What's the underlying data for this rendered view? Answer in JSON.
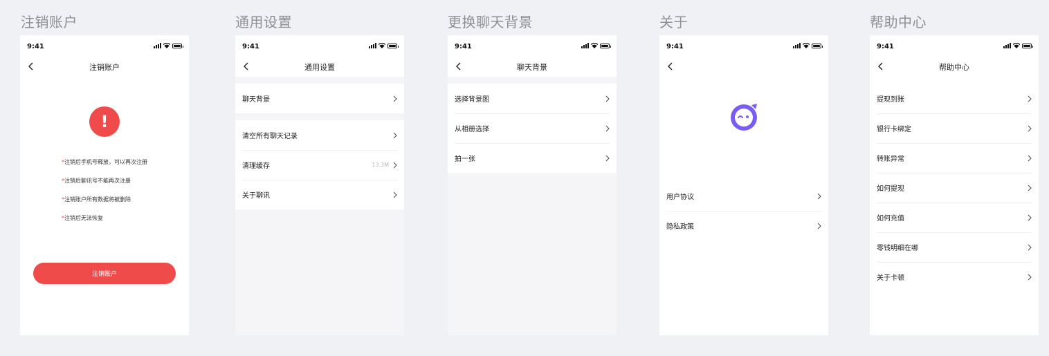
{
  "status": {
    "time": "9:41"
  },
  "screens": {
    "delete": {
      "section_title": "注销账户",
      "nav_title": "注销账户",
      "notes": [
        "注销后手机号释放，可以再次注册",
        "注销后聊讯号不能再次注册",
        "注销账户所有数据将被删除",
        "注销后无法恢复"
      ],
      "note_marker": "*",
      "warn_glyph": "!",
      "button": "注销账户"
    },
    "general": {
      "section_title": "通用设置",
      "nav_title": "通用设置",
      "group1": [
        {
          "label": "聊天背景"
        }
      ],
      "group2": [
        {
          "label": "清空所有聊天记录",
          "value": ""
        },
        {
          "label": "清理缓存",
          "value": "13.3M"
        },
        {
          "label": "关于聊讯",
          "value": ""
        }
      ]
    },
    "background": {
      "section_title": "更换聊天背景",
      "nav_title": "聊天背景",
      "items": [
        {
          "label": "选择背景图"
        },
        {
          "label": "从相册选择"
        },
        {
          "label": "拍一张"
        }
      ]
    },
    "about": {
      "section_title": "关于",
      "nav_title": "",
      "items": [
        {
          "label": "用户协议"
        },
        {
          "label": "隐私政策"
        }
      ]
    },
    "help": {
      "section_title": "帮助中心",
      "nav_title": "帮助中心",
      "items": [
        {
          "label": "提现到账"
        },
        {
          "label": "银行卡绑定"
        },
        {
          "label": "转账异常"
        },
        {
          "label": "如何提现"
        },
        {
          "label": "如何充值"
        },
        {
          "label": "零钱明细在哪"
        },
        {
          "label": "关于卡顿"
        }
      ]
    }
  },
  "colors": {
    "danger": "#f04b4b",
    "brand": "#7a5cf5",
    "page_bg": "#f0f1f5"
  },
  "icons": {
    "back": "chevron-left-icon",
    "row": "chevron-right-icon",
    "warning": "exclamation-icon",
    "logo": "wink-face-logo-icon"
  }
}
